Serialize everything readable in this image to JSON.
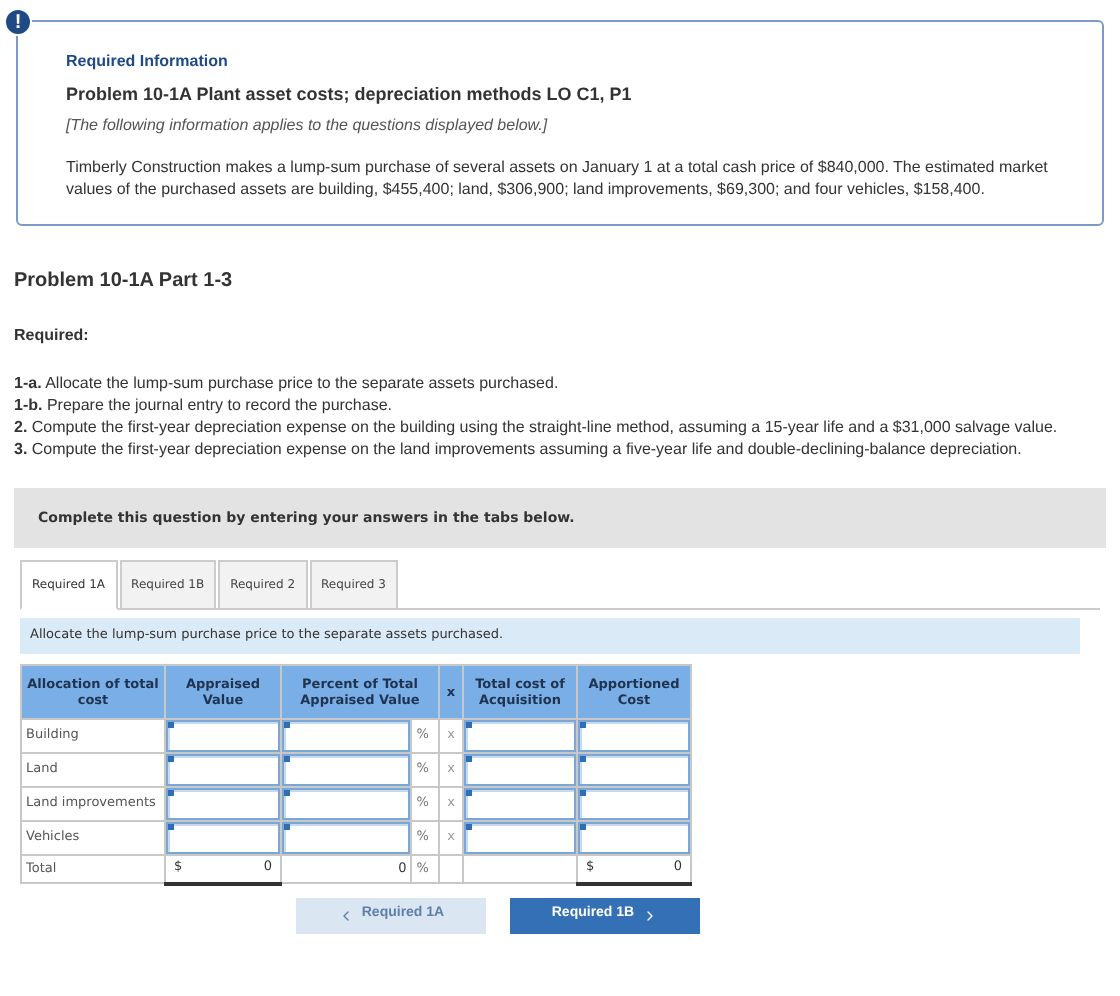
{
  "info": {
    "badge": "!",
    "heading": "Required Information",
    "title": "Problem 10-1A Plant asset costs; depreciation methods LO C1, P1",
    "note": "[The following information applies to the questions displayed below.]",
    "body": "Timberly Construction makes a lump-sum purchase of several assets on January 1 at a total cash price of $840,000. The estimated market values of the purchased assets are building, $455,400; land, $306,900; land improvements, $69,300; and four vehicles, $158,400."
  },
  "part_title": "Problem 10-1A Part 1-3",
  "required_label": "Required:",
  "requirements": [
    "**1-a.** Allocate the lump-sum purchase price to the separate assets purchased.",
    "**1-b.** Prepare the journal entry to record the purchase.",
    "**2.** Compute the first-year depreciation expense on the building using the straight-line method, assuming a 15-year life and a $31,000 salvage value.",
    "**3.** Compute the first-year depreciation expense on the land improvements assuming a five-year life and double-declining-balance depreciation."
  ],
  "prompt": "Complete this question by entering your answers in the tabs below.",
  "tabs": [
    {
      "label": "Required 1A",
      "selected": true
    },
    {
      "label": "Required 1B",
      "selected": false
    },
    {
      "label": "Required 2",
      "selected": false
    },
    {
      "label": "Required 3",
      "selected": false
    }
  ],
  "instruction": "Allocate the lump-sum purchase price to the separate assets purchased.",
  "table": {
    "columns": [
      "Allocation of total cost",
      "Appraised Value",
      "Percent of Total Appraised Value",
      "x",
      "Total cost of Acquisition",
      "Apportioned Cost"
    ],
    "rows": [
      {
        "kind": "input",
        "label": "Building",
        "percent_sign": "%",
        "times": "x"
      },
      {
        "kind": "input",
        "label": "Land",
        "percent_sign": "%",
        "times": "x"
      },
      {
        "kind": "input",
        "label": "Land improvements",
        "percent_sign": "%",
        "times": "x"
      },
      {
        "kind": "input",
        "label": "Vehicles",
        "percent_sign": "%",
        "times": "x"
      },
      {
        "kind": "total",
        "label": "Total",
        "appraised_currency": "$",
        "appraised": "0",
        "percent": "0",
        "percent_sign": "%",
        "apportioned_currency": "$",
        "apportioned": "0"
      }
    ]
  },
  "nav": [
    {
      "label": "Required 1A",
      "kind": "prev",
      "disabled": true
    },
    {
      "label": "Required 1B",
      "kind": "next",
      "disabled": false
    }
  ]
}
